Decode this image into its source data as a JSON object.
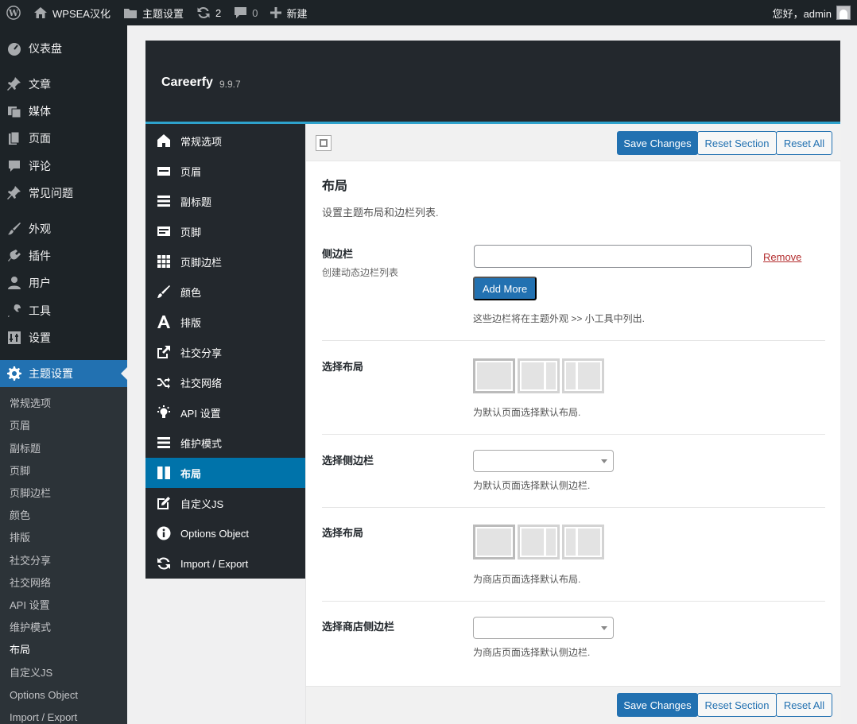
{
  "adminbar": {
    "site_name": "WPSEA汉化",
    "theme_settings": "主题设置",
    "updates_count": "2",
    "comments_count": "0",
    "new_label": "新建",
    "greeting": "您好，admin"
  },
  "menu": {
    "dashboard": "仪表盘",
    "posts": "文章",
    "media": "媒体",
    "pages": "页面",
    "comments": "评论",
    "faq": "常见问题",
    "appearance": "外观",
    "plugins": "插件",
    "users": "用户",
    "tools": "工具",
    "settings": "设置",
    "theme_settings": "主题设置"
  },
  "submenu": [
    "常规选项",
    "页眉",
    "副标题",
    "页脚",
    "页脚边栏",
    "颜色",
    "排版",
    "社交分享",
    "社交网络",
    "API 设置",
    "维护模式",
    "布局",
    "自定义JS",
    "Options Object",
    "Import / Export"
  ],
  "panel": {
    "title": "Careerfy",
    "version": "9.9.7"
  },
  "panel_nav": [
    "常规选项",
    "页眉",
    "副标题",
    "页脚",
    "页脚边栏",
    "颜色",
    "排版",
    "社交分享",
    "社交网络",
    "API 设置",
    "维护模式",
    "布局",
    "自定义JS",
    "Options Object",
    "Import / Export"
  ],
  "toolbar": {
    "save": "Save Changes",
    "reset_section": "Reset Section",
    "reset_all": "Reset All"
  },
  "section": {
    "title": "布局",
    "desc": "设置主题布局和边栏列表."
  },
  "fields": {
    "sidebar_label": "侧边栏",
    "sidebar_sub": "创建动态边栏列表",
    "sidebar_value": "",
    "remove": "Remove",
    "add_more": "Add More",
    "sidebar_desc": "这些边栏将在主题外观 >> 小工具中列出.",
    "layout_label": "选择布局",
    "layout_desc": "为默认页面选择默认布局.",
    "select_sidebar_label": "选择侧边栏",
    "select_sidebar_desc": "为默认页面选择默认侧边栏.",
    "shop_layout_label": "选择布局",
    "shop_layout_desc": "为商店页面选择默认布局.",
    "shop_sidebar_label": "选择商店侧边栏",
    "shop_sidebar_desc": "为商店页面选择默认侧边栏."
  },
  "colors": {
    "accent": "#2271b1",
    "active_nav": "#0073aa",
    "dark": "#1d2327",
    "remove": "#b32d2e"
  }
}
